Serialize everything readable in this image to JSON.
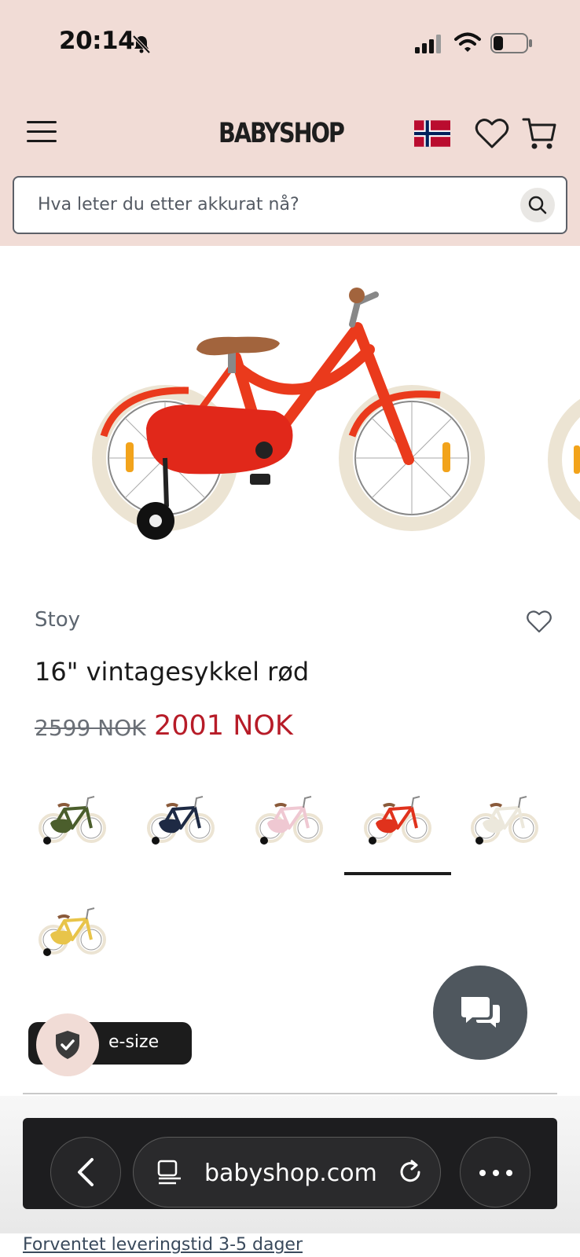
{
  "status_bar": {
    "time": "20:14"
  },
  "header": {
    "logo_text": "BABYSHOP",
    "flag_country": "norway",
    "icons": [
      "menu-icon",
      "heart-icon",
      "cart-icon"
    ]
  },
  "search": {
    "placeholder": "Hva leter du etter akkurat nå?"
  },
  "product": {
    "brand": "Stoy",
    "title": "16\" vintagesykkel rød",
    "price_old": "2599 NOK",
    "price_new": "2001 NOK"
  },
  "variants": [
    {
      "color": "#4b5e2c",
      "selected": false
    },
    {
      "color": "#1e2a44",
      "selected": false
    },
    {
      "color": "#efc8d2",
      "selected": false
    },
    {
      "color": "#e0321c",
      "selected": true
    },
    {
      "color": "#ece8dc",
      "selected": false
    },
    {
      "color": "#e8c44a",
      "selected": false
    }
  ],
  "size_pill": {
    "label": "e-size"
  },
  "browser": {
    "url": "babyshop.com"
  },
  "footer": {
    "delivery_text": "Forventet leveringstid 3-5 dager"
  },
  "colors": {
    "header_bg": "#f1dcd6",
    "sale_red": "#b71c28",
    "chat_bg": "#4f575e"
  }
}
